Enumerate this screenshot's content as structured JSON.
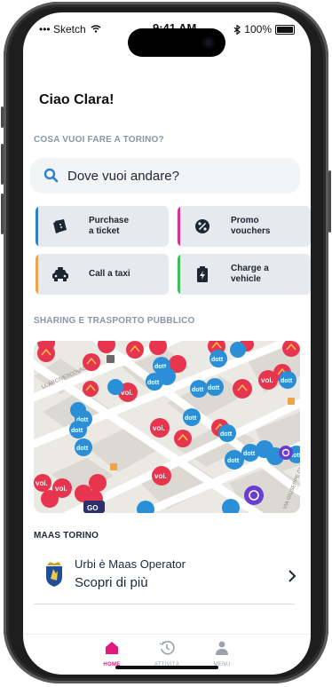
{
  "status_bar": {
    "carrier": "Sketch",
    "time": "9:41 AM",
    "battery": "100%"
  },
  "greeting": "Ciao Clara!",
  "section_what_to_do": "COSA VUOI FARE A TORINO?",
  "search": {
    "placeholder": "Dove vuoi andare?"
  },
  "actions": [
    {
      "label_line1": "Purchase",
      "label_line2": "a ticket",
      "icon": "ticket-icon",
      "accent": "#2f80c8"
    },
    {
      "label_line1": "Promo",
      "label_line2": "vouchers",
      "icon": "percent-badge-icon",
      "accent": "#d6338f"
    },
    {
      "label_line1": "Call a taxi",
      "label_line2": "",
      "icon": "taxi-icon",
      "accent": "#f2a24b"
    },
    {
      "label_line1": "Charge a",
      "label_line2": "vehicle",
      "icon": "battery-charge-icon",
      "accent": "#3cbf5a"
    }
  ],
  "section_sharing": "SHARING E TRASPORTO PUBBLICO",
  "map": {
    "street_1": "LL'ARCIVESCOVADO",
    "street_2": "VIA GIUSEPPE GI",
    "pin_dott": "dott",
    "pin_voi": "voi.",
    "pin_goo": "GO"
  },
  "section_maas": "MAAS TORINO",
  "maas": {
    "title": "Urbi è Maas Operator",
    "subtitle": "Scopri di più",
    "icon": "torino-crest-icon"
  },
  "tabs": [
    {
      "label": "HOME",
      "icon": "home-icon",
      "active": true
    },
    {
      "label": "ATTIVITÀ",
      "icon": "history-icon",
      "active": false
    },
    {
      "label": "MENU",
      "icon": "user-icon",
      "active": false
    }
  ],
  "colors": {
    "accent": "#e0197d",
    "dott": "#2a8fd6",
    "voi": "#e8354f"
  }
}
